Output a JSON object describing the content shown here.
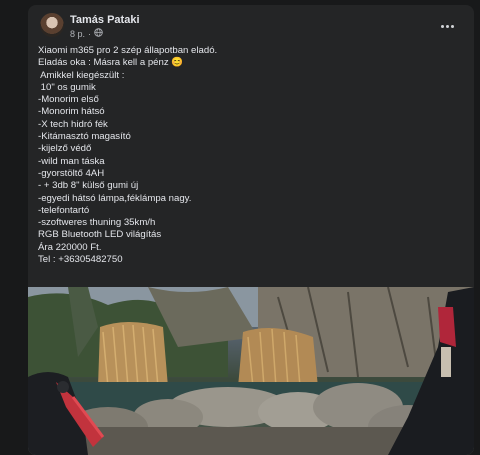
{
  "post": {
    "author": "Tamás Pataki",
    "time": "8 p.",
    "lines": [
      "Xiaomi m365 pro 2 szép állapotban eladó.",
      "Eladás oka : Másra kell a pénz 😊",
      " Amikkel kiegészült :",
      " 10\" os gumik",
      "-Monorim első",
      "-Monorim hátsó",
      "-X tech hidró fék",
      "-Kitámasztó magasító",
      "-kijelző védő",
      "-wild man táska",
      "-gyorstöltő 4AH",
      "- + 3db 8\" külső gumi új",
      "-egyedi hátsó lámpa,féklámpa nagy.",
      "-telefontartó",
      "-szoftweres thuning 35km/h",
      "RGB Bluetooth LED világítás",
      "Ára 220000 Ft.",
      "Tel : +36305482750"
    ]
  },
  "icons": {
    "audience": "globe-icon",
    "menu": "more-options-icon"
  },
  "colors": {
    "background": "#18191a",
    "card": "#242526",
    "text": "#e4e6eb",
    "muted": "#b0b3b8"
  }
}
